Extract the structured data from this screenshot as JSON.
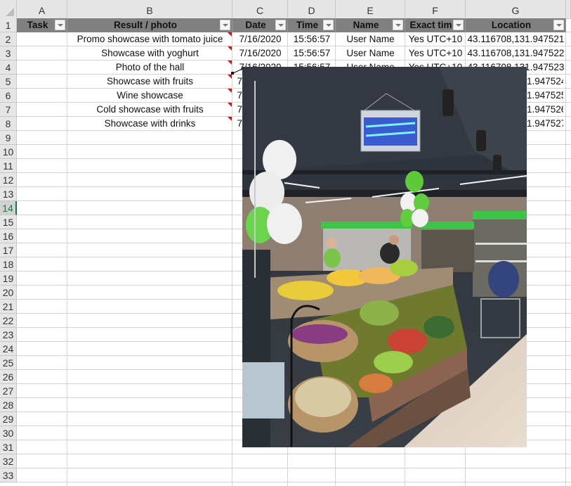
{
  "columns": [
    "A",
    "B",
    "C",
    "D",
    "E",
    "F",
    "G"
  ],
  "rows": [
    "1",
    "2",
    "3",
    "4",
    "5",
    "6",
    "7",
    "8",
    "9",
    "10",
    "11",
    "12",
    "13",
    "14",
    "15",
    "16",
    "17",
    "18",
    "19",
    "20",
    "21",
    "22",
    "23",
    "24",
    "25",
    "26",
    "27",
    "28",
    "29",
    "30",
    "31",
    "32",
    "33"
  ],
  "selected_row": "14",
  "table": {
    "headers": [
      "Task",
      "Result / photo",
      "Date",
      "Time",
      "Name",
      "Exact tim",
      "Location"
    ],
    "records": [
      {
        "task": "",
        "result": "Promo showcase with tomato juice",
        "date": "7/16/2020",
        "time": "15:56:57",
        "name": "User Name",
        "exact": "Yes UTC+10",
        "location": "43.116708,131.947521"
      },
      {
        "task": "",
        "result": "Showcase with yoghurt",
        "date": "7/16/2020",
        "time": "15:56:57",
        "name": "User Name",
        "exact": "Yes UTC+10",
        "location": "43.116708,131.947522"
      },
      {
        "task": "",
        "result": "Photo of the hall",
        "date": "7/16/2020",
        "time": "15:56:57",
        "name": "User Name",
        "exact": "Yes UTC+10",
        "location": "43.116708,131.947523"
      },
      {
        "task": "",
        "result": "Showcase with fruits",
        "date": "7",
        "time": "",
        "name": "",
        "exact": "",
        "location": "1.947524"
      },
      {
        "task": "",
        "result": "Wine showcase",
        "date": "7",
        "time": "",
        "name": "",
        "exact": "",
        "location": "1.947525"
      },
      {
        "task": "",
        "result": "Cold showcase with fruits",
        "date": "7",
        "time": "",
        "name": "",
        "exact": "",
        "location": "1.947526"
      },
      {
        "task": "",
        "result": "Showcase with drinks",
        "date": "7",
        "time": "",
        "name": "",
        "exact": "",
        "location": "1.947527"
      }
    ]
  },
  "comment_photo": {
    "description": "Supermarket hall with fruit showcase, balloons and insect lamp",
    "attached_to_row": "4"
  },
  "colors": {
    "header_band": "#808080",
    "comment_indicator": "#c4161c",
    "selection_accent": "#217346",
    "gridline": "#d4d4d4"
  }
}
